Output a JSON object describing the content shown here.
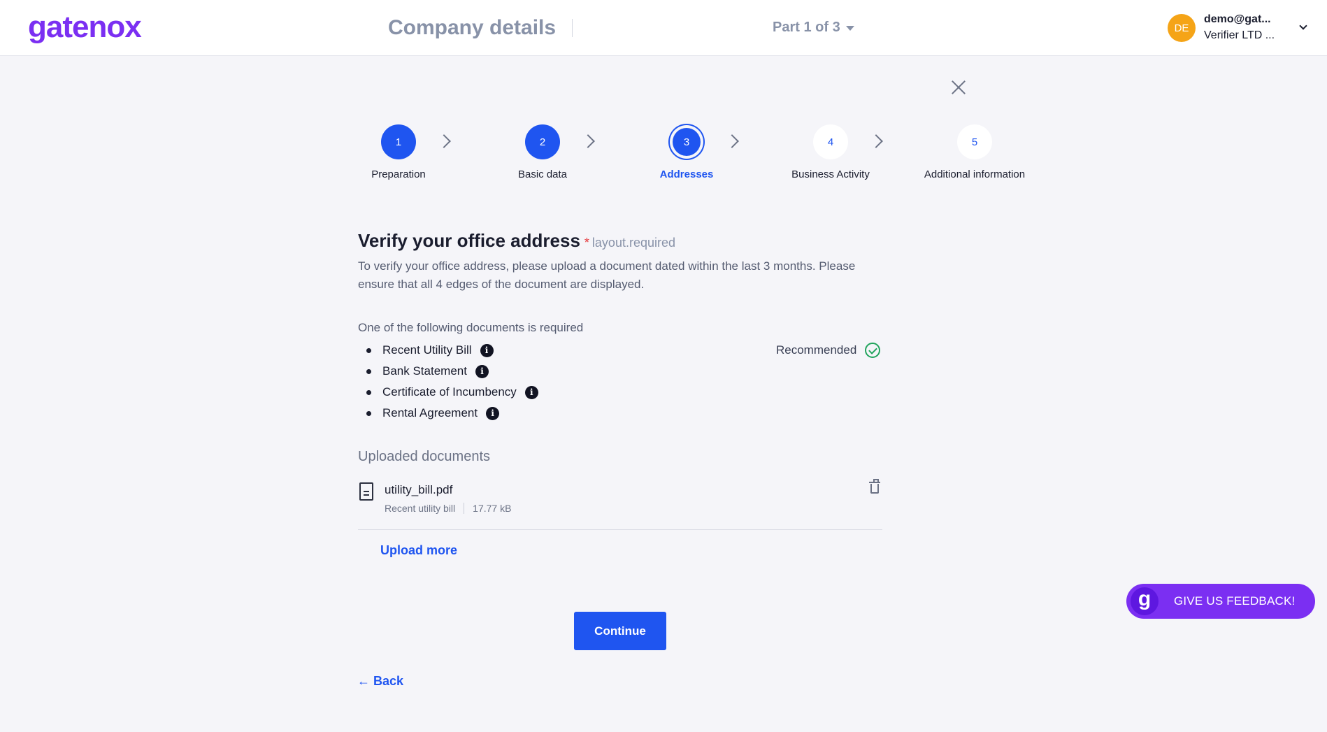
{
  "header": {
    "logo": "gatenox",
    "page_title": "Company details",
    "part_label": "Part 1 of 3",
    "user": {
      "initials": "DE",
      "email": "demo@gat...",
      "company": "Verifier LTD ...",
      "avatar_color": "#f5a417"
    }
  },
  "stepper": {
    "steps": [
      {
        "number": "1",
        "label": "Preparation",
        "state": "done"
      },
      {
        "number": "2",
        "label": "Basic data",
        "state": "done"
      },
      {
        "number": "3",
        "label": "Addresses",
        "state": "active"
      },
      {
        "number": "4",
        "label": "Business Activity",
        "state": "pending"
      },
      {
        "number": "5",
        "label": "Additional information",
        "state": "pending"
      }
    ]
  },
  "section": {
    "heading": "Verify your office address",
    "required_star": "*",
    "required_text": "layout.required",
    "description": "To verify your office address, please upload a document dated within the last 3 months. Please ensure that all 4 edges of the document are displayed.",
    "docs_intro": "One of the following documents is required",
    "documents": [
      {
        "label": "Recent Utility Bill",
        "info_icon": "info-icon"
      },
      {
        "label": "Bank Statement",
        "info_icon": "info-icon"
      },
      {
        "label": "Certificate of Incumbency",
        "info_icon": "info-icon"
      },
      {
        "label": "Rental Agreement",
        "info_icon": "info-icon"
      }
    ],
    "recommended_label": "Recommended",
    "info_glyph": "i"
  },
  "uploads": {
    "heading": "Uploaded documents",
    "files": [
      {
        "name": "utility_bill.pdf",
        "type": "Recent utility bill",
        "size": "17.77 kB"
      }
    ],
    "upload_more_label": "Upload more"
  },
  "actions": {
    "continue_label": "Continue",
    "back_label": "← Back"
  },
  "feedback": {
    "icon_letter": "g",
    "label": "GIVE US FEEDBACK!"
  },
  "colors": {
    "brand_purple": "#7b2ff2",
    "primary_blue": "#1f55f0",
    "success_green": "#22a45d",
    "required_red": "#e5383b"
  }
}
